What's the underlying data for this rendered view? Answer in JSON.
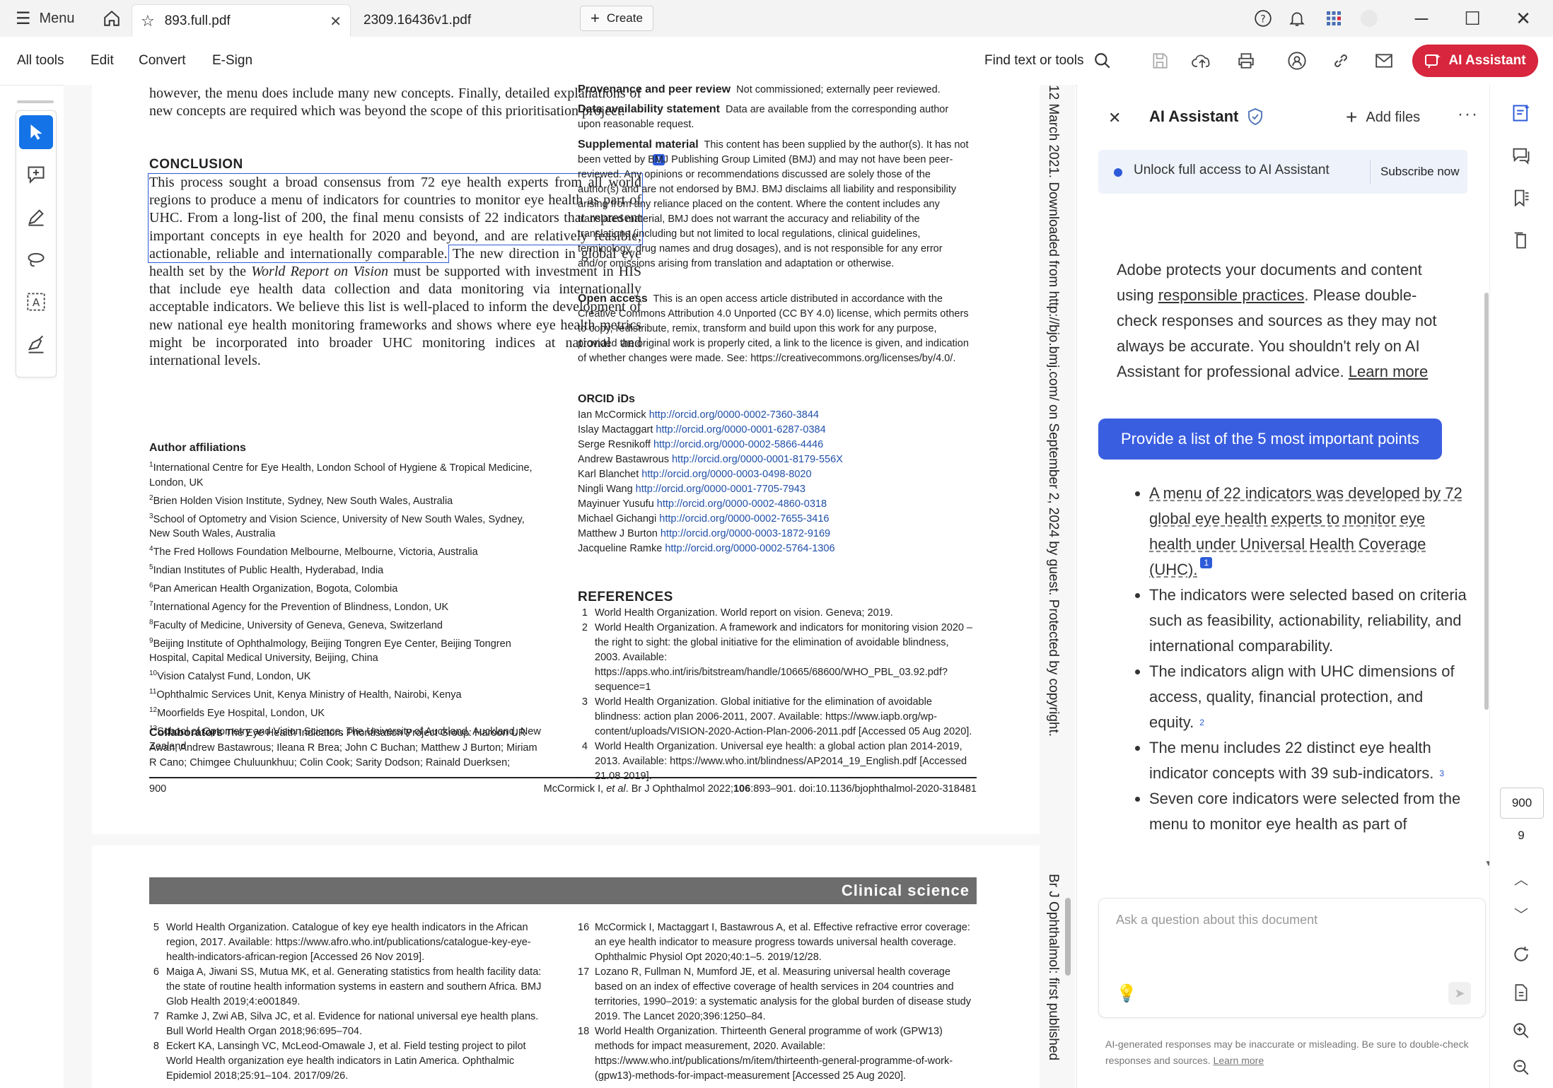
{
  "titlebar": {
    "menu_label": "Menu",
    "tabs": [
      {
        "label": "893.full.pdf"
      },
      {
        "label": "2309.16436v1.pdf"
      }
    ],
    "create_label": "Create"
  },
  "toolbar": {
    "items": [
      "All tools",
      "Edit",
      "Convert",
      "E-Sign"
    ],
    "find_label": "Find text or tools",
    "ai_button_label": "AI Assistant"
  },
  "doc": {
    "intro_lines": "however, the menu does include many new concepts. Finally, detailed explanations of new concepts are required which was beyond the scope of this prioritisation project.",
    "conclusion_heading": "CONCLUSION",
    "conclusion_highlight": "This process sought a broad consensus from 72 eye health experts from all world regions to produce a menu of indicators for countries to monitor eye health as part of UHC. From a long-list of 200, the final menu consists of 22 indicators that represent important concepts in eye health for 2020 and beyond, and are relatively feasible, actionable, reliable and internationally comparable.",
    "conclusion_rest_a": " The new direction in global eye health set by the ",
    "conclusion_rest_italic": "World Report on Vision",
    "conclusion_rest_b": " must be supported with investment in HIS that include eye health data collection and data monitoring via internationally acceptable indicators. We believe this list is well-placed to inform the development of new national eye health monitoring frameworks and shows where eye health metrics might be incorporated into broader UHC monitoring indices at national and international levels.",
    "affil_heading": "Author affiliations",
    "affiliations": [
      {
        "n": "1",
        "t": "International Centre for Eye Health, London School of Hygiene & Tropical Medicine, London, UK"
      },
      {
        "n": "2",
        "t": "Brien Holden Vision Institute, Sydney, New South Wales, Australia"
      },
      {
        "n": "3",
        "t": "School of Optometry and Vision Science, University of New South Wales, Sydney, New South Wales, Australia"
      },
      {
        "n": "4",
        "t": "The Fred Hollows Foundation Melbourne, Melbourne, Victoria, Australia"
      },
      {
        "n": "5",
        "t": "Indian Institutes of Public Health, Hyderabad, India"
      },
      {
        "n": "6",
        "t": "Pan American Health Organization, Bogota, Colombia"
      },
      {
        "n": "7",
        "t": "International Agency for the Prevention of Blindness, London, UK"
      },
      {
        "n": "8",
        "t": "Faculty of Medicine, University of Geneva, Geneva, Switzerland"
      },
      {
        "n": "9",
        "t": "Beijing Institute of Ophthalmology, Beijing Tongren Eye Center, Beijing Tongren Hospital, Capital Medical University, Beijing, China"
      },
      {
        "n": "10",
        "t": "Vision Catalyst Fund, London, UK"
      },
      {
        "n": "11",
        "t": "Ophthalmic Services Unit, Kenya Ministry of Health, Nairobi, Kenya"
      },
      {
        "n": "12",
        "t": "Moorfields Eye Hospital, London, UK"
      },
      {
        "n": "13",
        "t": "School of Optometry and Vision Science, The University of Auckland, Auckland, New Zealand"
      }
    ],
    "collab_heading": "Collaborators",
    "collab_text": " The Eye Health Indicators Prioritisation Project Group: Haroon UR Awan; Andrew Bastawrous; Ileana R Brea; John C Buchan; Matthew J Burton; Miriam R Cano; Chimgee Chuluunkhuu; Colin Cook; Sarity Dodson; Rainald Duerksen;",
    "provenance_heading": "Provenance and peer review",
    "provenance_text": "Not commissioned; externally peer reviewed.",
    "data_heading": "Data availability statement",
    "data_text": "Data are available from the corresponding author upon reasonable request.",
    "supp_heading": "Supplemental material",
    "supp_text": "This content has been supplied by the author(s). It has not been vetted by BMJ Publishing Group Limited (BMJ) and may not have been peer-reviewed. Any opinions or recommendations discussed are solely those of the author(s) and are not endorsed by BMJ. BMJ disclaims all liability and responsibility arising from any reliance placed on the content. Where the content includes any translated material, BMJ does not warrant the accuracy and reliability of the translations (including but not limited to local regulations, clinical guidelines, terminology, drug names and drug dosages), and is not responsible for any error and/or omissions arising from translation and adaptation or otherwise.",
    "open_heading": "Open access",
    "open_text": "This is an open access article distributed in accordance with the Creative Commons Attribution 4.0 Unported (CC BY 4.0) license, which permits others to copy, redistribute, remix, transform and build upon this work for any purpose, provided the original work is properly cited, a link to the licence is given, and indication of whether changes were made. See: https://creativecommons.org/licenses/by/4.0/.",
    "orcid_heading": "ORCID iDs",
    "orcids": [
      {
        "name": "Ian McCormick",
        "url": "http://orcid.org/0000-0002-7360-3844"
      },
      {
        "name": "Islay Mactaggart",
        "url": "http://orcid.org/0000-0001-6287-0384"
      },
      {
        "name": "Serge Resnikoff",
        "url": "http://orcid.org/0000-0002-5866-4446"
      },
      {
        "name": "Andrew Bastawrous",
        "url": "http://orcid.org/0000-0001-8179-556X"
      },
      {
        "name": "Karl Blanchet",
        "url": "http://orcid.org/0000-0003-0498-8020"
      },
      {
        "name": "Ningli Wang",
        "url": "http://orcid.org/0000-0001-7705-7943"
      },
      {
        "name": "Mayinuer Yusufu",
        "url": "http://orcid.org/0000-0002-4860-0318"
      },
      {
        "name": "Michael Gichangi",
        "url": "http://orcid.org/0000-0002-7655-3416"
      },
      {
        "name": "Matthew J Burton",
        "url": "http://orcid.org/0000-0003-1872-9169"
      },
      {
        "name": "Jacqueline Ramke",
        "url": "http://orcid.org/0000-0002-5764-1306"
      }
    ],
    "ref_heading": "REFERENCES",
    "references": [
      {
        "n": "1",
        "t": "World Health Organization. World report on vision. Geneva; 2019."
      },
      {
        "n": "2",
        "t": "World Health Organization. A framework and indicators for monitoring vision 2020 – the right to sight: the global initiative for the elimination of avoidable blindness, 2003. Available: https://apps.who.int/iris/bitstream/handle/10665/68600/WHO_PBL_03.92.pdf?sequence=1"
      },
      {
        "n": "3",
        "t": "World Health Organization. Global initiative for the elimination of avoidable blindness: action plan 2006-2011, 2007. Available: https://www.iapb.org/wp-content/uploads/VISION-2020-Action-Plan-2006-2011.pdf [Accessed 05 Aug 2020]."
      },
      {
        "n": "4",
        "t": "World Health Organization. Universal eye health: a global action plan 2014-2019, 2013. Available: https://www.who.int/blindness/AP2014_19_English.pdf [Accessed 21.08 2019]."
      }
    ],
    "footer_page": "900",
    "footer_citation_a": "McCormick I, ",
    "footer_citation_etal": "et al",
    "footer_citation_b": ". Br J Ophthalmol ",
    "footer_citation_c": "2022;",
    "footer_citation_vol": "106",
    "footer_citation_d": ":893–901. doi:10.1136/bjophthalmol-2020-318481",
    "side_strip_top": "12 March 2021. Downloaded from http://bjo.bmj.com/ on September 2, 2024 by guest. Protected by copyright.",
    "side_strip_bottom": "Br J Ophthalmol: first published",
    "p2_banner": "Clinical science",
    "p2_refs_left": [
      {
        "n": "5",
        "t": "World Health Organization. Catalogue of key eye health indicators in the African region, 2017. Available: https://www.afro.who.int/publications/catalogue-key-eye-health-indicators-african-region [Accessed 26 Nov 2019]."
      },
      {
        "n": "6",
        "t": "Maiga A, Jiwani SS, Mutua MK, et al. Generating statistics from health facility data: the state of routine health information systems in eastern and southern Africa. BMJ Glob Health 2019;4:e001849."
      },
      {
        "n": "7",
        "t": "Ramke J, Zwi AB, Silva JC, et al. Evidence for national universal eye health plans. Bull World Health Organ 2018;96:695–704."
      },
      {
        "n": "8",
        "t": "Eckert KA, Lansingh VC, McLeod-Omawale J, et al. Field testing project to pilot World Health organization eye health indicators in Latin America. Ophthalmic Epidemiol 2018;25:91–104. 2017/09/26."
      }
    ],
    "p2_refs_right": [
      {
        "n": "16",
        "t": "McCormick I, Mactaggart I, Bastawrous A, et al. Effective refractive error coverage: an eye health indicator to measure progress towards universal health coverage. Ophthalmic Physiol Opt 2020;40:1–5. 2019/12/28."
      },
      {
        "n": "17",
        "t": "Lozano R, Fullman N, Mumford JE, et al. Measuring universal health coverage based on an index of effective coverage of health services in 204 countries and territories, 1990–2019: a systematic analysis for the global burden of disease study 2019. The Lancet 2020;396:1250–84."
      },
      {
        "n": "18",
        "t": "World Health Organization. Thirteenth General programme of work (GPW13) methods for impact measurement, 2020. Available: https://www.who.int/publications/m/item/thirteenth-general-programme-of-work-(gpw13)-methods-for-impact-measurement [Accessed 25 Aug 2020]."
      }
    ],
    "highlight_marker": "1"
  },
  "ai_panel": {
    "title": "AI Assistant",
    "add_files": "Add files",
    "unlock_text": "Unlock full access to AI Assistant",
    "subscribe_label": "Subscribe now",
    "notice_a": "Adobe protects your documents and content using ",
    "notice_link": "responsible practices",
    "notice_b": ". Please double-check responses and sources as they may not always be accurate. You shouldn't rely on AI Assistant for professional advice. ",
    "notice_learn": "Learn more",
    "prompt_chip": "Provide a list of the 5 most important points",
    "bullets": [
      {
        "text": "A menu of 22 indicators was developed by 72 global eye health experts to monitor eye health under Universal Health Coverage (UHC).",
        "cite": "1"
      },
      {
        "text": "The indicators were selected based on criteria such as feasibility, actionability, reliability, and international comparability.",
        "cite": ""
      },
      {
        "text": "The indicators align with UHC dimensions of access, quality, financial protection, and equity.",
        "cite": "2"
      },
      {
        "text": "The menu includes 22 distinct eye health indicator concepts with 39 sub-indicators.",
        "cite": "3"
      },
      {
        "text": "Seven core indicators were selected from the menu to monitor eye health as part of",
        "cite": ""
      }
    ],
    "input_placeholder": "Ask a question about this document",
    "disclaimer_a": "AI-generated responses may be inaccurate or misleading. Be sure to double-check responses and sources. ",
    "disclaimer_learn": "Learn more"
  },
  "rightrail": {
    "page_number": "900",
    "page_total": "9"
  },
  "colors": {
    "accent_red": "#d7263d",
    "ai_blue": "#2d5bd9",
    "link_blue": "#1f4fa8",
    "banner_gray": "#6d6d6d"
  }
}
